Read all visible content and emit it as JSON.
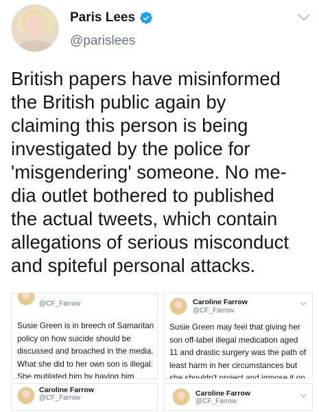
{
  "author": {
    "display_name": "Paris Lees",
    "handle": "@parislees",
    "verified": true,
    "avatar_icon": "profile-photo"
  },
  "tweet": {
    "text_lines": [
      "British papers have misinformed",
      "the British public again by",
      "claiming this person is being",
      "investigated by the police for",
      "'misgendering' someone. No me-",
      "dia outlet bothered to published",
      "the actual tweets, which contain",
      "allegations of serious misconduct",
      "and spiteful personal attacks."
    ]
  },
  "media": [
    {
      "name": "",
      "handle": "@CF_Farrow",
      "text_lines": [
        "Susie Green is in breech of Samaritan",
        "policy on how suicide should be",
        "discussed and broached in the media.",
        "What she did to her own son is illegal.",
        "She mutilated him by having him"
      ]
    },
    {
      "name": "Caroline Farrow",
      "handle": "@CF_Farrow",
      "text_lines": [
        "Susie Green may feel that giving her",
        "son off-label illegal medication aged",
        "11 and drastic surgery was the path of",
        "least harm in her circumstances but",
        "she shouldn't project and impose it on"
      ]
    },
    {
      "name": "Caroline Farrow",
      "handle": "@CF_Farrow",
      "text_lines": []
    },
    {
      "name": "Caroline Farrow",
      "handle": "@CF_Farrow",
      "text_lines": []
    }
  ],
  "colors": {
    "verified": "#1da1f2",
    "text": "#14171a",
    "secondary": "#657786"
  }
}
